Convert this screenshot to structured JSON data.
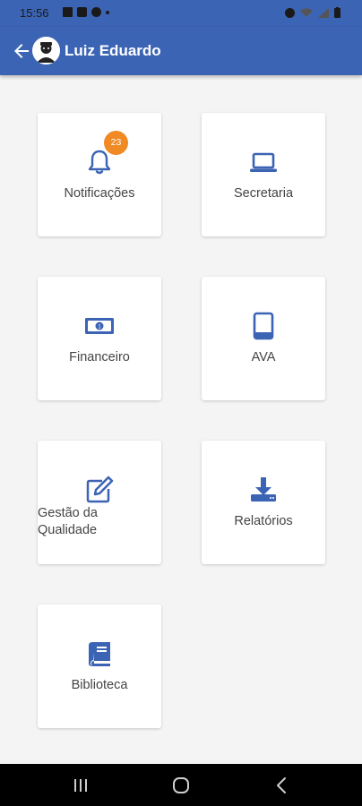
{
  "status_bar": {
    "time": "15:56",
    "left_icons": [
      "image-icon",
      "message-icon",
      "data-saver-icon",
      "dot-icon"
    ],
    "right_icons": [
      "alarm-icon",
      "wifi-icon",
      "signal-icon",
      "battery-icon"
    ]
  },
  "app_bar": {
    "title": "Luiz Eduardo",
    "back_icon": "arrow-back-icon",
    "avatar_icon": "user-avatar-icon",
    "color": "#3c64b4"
  },
  "menu": {
    "accent_color": "#3c64b4",
    "badge_color": "#f08a24",
    "items": [
      {
        "label": "Notificações",
        "icon": "bell-icon",
        "badge": "23"
      },
      {
        "label": "Secretaria",
        "icon": "laptop-icon"
      },
      {
        "label": "Financeiro",
        "icon": "money-icon"
      },
      {
        "label": "AVA",
        "icon": "tablet-icon"
      },
      {
        "label": "Gestão da Qualidade",
        "icon": "edit-icon"
      },
      {
        "label": "Relatórios",
        "icon": "download-icon"
      },
      {
        "label": "Biblioteca",
        "icon": "book-icon"
      }
    ]
  },
  "nav_bar": {
    "buttons": [
      "recent-apps-icon",
      "home-icon",
      "back-icon"
    ]
  }
}
